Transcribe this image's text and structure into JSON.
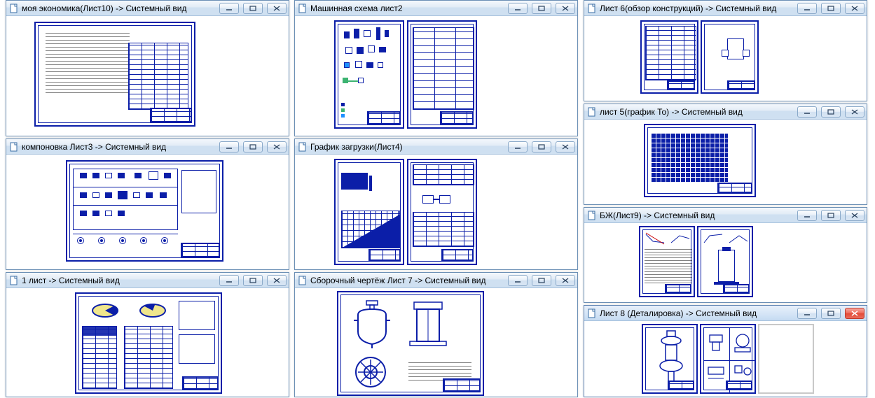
{
  "windows": [
    {
      "id": "w0",
      "title": "моя экономика(Лист10) -> Системный вид"
    },
    {
      "id": "w1",
      "title": "Машинная схема лист2"
    },
    {
      "id": "w2",
      "title": "Лист 6(обзор конструкций) -> Системный вид"
    },
    {
      "id": "w3",
      "title": "лист 5(график То) -> Системный вид"
    },
    {
      "id": "w4",
      "title": "компоновка Лист3 -> Системный вид"
    },
    {
      "id": "w5",
      "title": "График загрузки(Лист4)"
    },
    {
      "id": "w6",
      "title": "БЖ(Лист9) -> Системный вид"
    },
    {
      "id": "w7",
      "title": "1 лист -> Системный вид"
    },
    {
      "id": "w8",
      "title": "Сборочный чертёж Лист 7 -> Системный вид"
    },
    {
      "id": "w9",
      "title": "Лист 8 (Деталировка) -> Системный вид",
      "active": true
    }
  ],
  "buttons": {
    "minimize": "minimize",
    "maximize": "maximize",
    "close": "close"
  }
}
